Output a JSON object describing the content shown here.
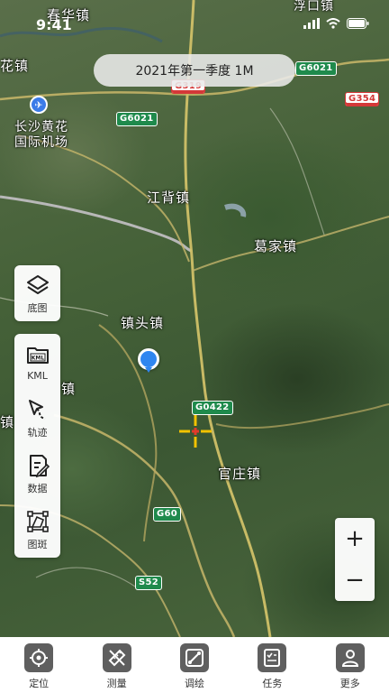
{
  "status": {
    "time": "9:41"
  },
  "map_date": "2021年第一季度 1M",
  "places": {
    "chunhua": "春华镇",
    "hua": "花镇",
    "airport_line1": "长沙黄花",
    "airport_line2": "国际机场",
    "jiangbei": "江背镇",
    "gejia": "葛家镇",
    "zhentou": "镇头镇",
    "guanzhuang": "官庄镇",
    "fukou": "浮口镇",
    "zhen_left": "镇",
    "zhen_mid": "镇"
  },
  "roads": {
    "g319": "G319",
    "g6021_top": "G6021",
    "g6021_left": "G6021",
    "g354": "G354",
    "g0422": "G0422",
    "g60": "G60",
    "s52": "S52"
  },
  "tools": {
    "basemap": "底图",
    "kml": "KML",
    "kml_badge": "KML",
    "track": "轨迹",
    "data": "数据",
    "patch": "图斑"
  },
  "zoom": {
    "in": "+",
    "out": "−"
  },
  "tabs": [
    {
      "label": "定位",
      "icon": "locate-icon"
    },
    {
      "label": "测量",
      "icon": "measure-icon"
    },
    {
      "label": "调绘",
      "icon": "survey-draw-icon"
    },
    {
      "label": "任务",
      "icon": "task-icon"
    },
    {
      "label": "更多",
      "icon": "more-icon"
    }
  ]
}
